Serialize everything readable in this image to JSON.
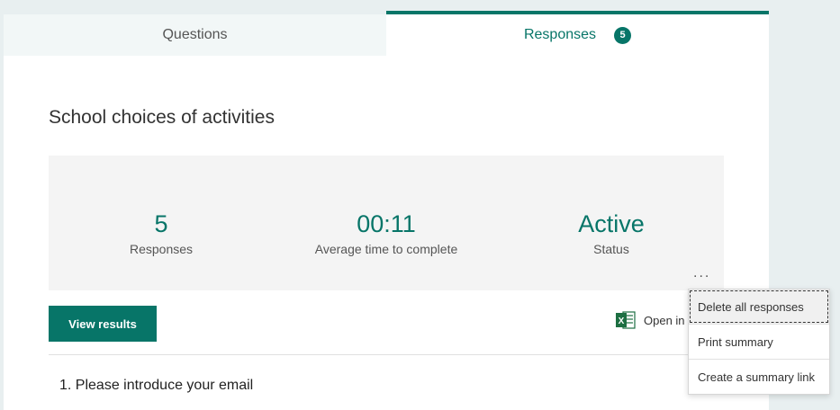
{
  "tabs": {
    "questions_label": "Questions",
    "responses_label": "Responses",
    "responses_count": "5"
  },
  "form": {
    "title": "School choices of activities"
  },
  "stats": {
    "responses_value": "5",
    "responses_label": "Responses",
    "avg_time_value": "00:11",
    "avg_time_label": "Average time to complete",
    "status_value": "Active",
    "status_label": "Status",
    "more_label": "..."
  },
  "actions": {
    "view_results_label": "View results",
    "open_excel_label": "Open in"
  },
  "questions": [
    {
      "text": "1.  Please introduce your email"
    }
  ],
  "menu": {
    "items": [
      {
        "label": "Delete all responses"
      },
      {
        "label": "Print summary"
      },
      {
        "label": "Create a summary link"
      }
    ]
  },
  "colors": {
    "accent": "#077568",
    "excel": "#1d6f42"
  },
  "icons": {
    "excel": "excel-icon",
    "more": "more-options-icon"
  }
}
